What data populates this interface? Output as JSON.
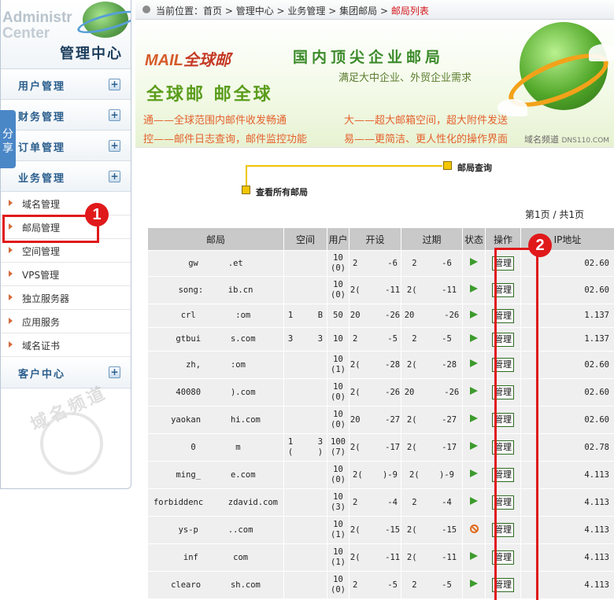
{
  "sidebar": {
    "logo_en_line1": "Administr",
    "logo_en_line2": "Center",
    "logo_cn": "管理中心",
    "sections": [
      {
        "label": "用户管理"
      },
      {
        "label": "财务管理"
      },
      {
        "label": "订单管理"
      },
      {
        "label": "业务管理"
      }
    ],
    "sub_items": [
      {
        "label": "域名管理"
      },
      {
        "label": "邮局管理"
      },
      {
        "label": "空间管理"
      },
      {
        "label": "VPS管理"
      },
      {
        "label": "独立服务器"
      },
      {
        "label": "应用服务"
      },
      {
        "label": "域名证书"
      }
    ],
    "customer_center": "客户中心",
    "expand_symbol": "+",
    "watermark_text": "域名频道"
  },
  "share_tab": "分享",
  "annotations": {
    "one": "1",
    "two": "2"
  },
  "breadcrumb": {
    "prefix": "当前位置：",
    "items": [
      "首页",
      "管理中心",
      "业务管理",
      "集团邮局"
    ],
    "current": "邮局列表",
    "separator": " > "
  },
  "banner": {
    "mail_logo_en": "MAIL",
    "mail_logo_cn": "全球邮",
    "slogan": "全球邮 邮全球",
    "headline": "国内顶尖企业邮局",
    "subheadline": "满足大中企业、外贸企业需求",
    "features": [
      "通——全球范围内邮件收发畅通",
      "大——超大邮箱空间，超大附件发送",
      "控——邮件日志查询，邮件监控功能",
      "易——更简洁、更人性化的操作界面"
    ],
    "brand_cn": "域名频道",
    "brand_en": "DNS110.COM"
  },
  "query": {
    "title": "邮局查询",
    "view_all": "查看所有邮局"
  },
  "pagination": "第1页 / 共1页",
  "table": {
    "headers": [
      "邮局",
      "空间",
      "用户",
      "开设",
      "过期",
      "状态",
      "操作",
      "IP地址"
    ],
    "action_label": "管理",
    "rows": [
      {
        "domain": "gw      .et",
        "space": "",
        "users": "10\n(0)",
        "opened": "2      -6",
        "expires": "2     -6",
        "status": "active",
        "ip": "02.60"
      },
      {
        "domain": "song:     ib.cn",
        "space": "",
        "users": "10\n(0)",
        "opened": "2(     -11",
        "expires": "2(     -11",
        "status": "active",
        "ip": "02.60"
      },
      {
        "domain": "crl        :om",
        "space": "1     B",
        "users": "50",
        "opened": "20     -26",
        "expires": "20      -26",
        "status": "active",
        "ip": "1.137"
      },
      {
        "domain": "gtbui      s.com",
        "space": "3     3",
        "users": "10",
        "opened": "2      -5",
        "expires": "2     -5",
        "status": "active",
        "ip": "1.137"
      },
      {
        "domain": "zh,      :om",
        "space": "",
        "users": "10\n(1)",
        "opened": "2(     -28",
        "expires": "2(     -28",
        "status": "active",
        "ip": "02.60"
      },
      {
        "domain": "40080      ).com",
        "space": "",
        "users": "10\n(0)",
        "opened": "2(     -26",
        "expires": "20      -26",
        "status": "active",
        "ip": "02.60"
      },
      {
        "domain": "yaokan      hi.com",
        "space": "",
        "users": "10\n(0)",
        "opened": "20     -27",
        "expires": "2(     -27",
        "status": "active",
        "ip": "02.60"
      },
      {
        "domain": "0        m",
        "space": "1     3\n(     )",
        "users": "100\n(7)",
        "opened": "2(     -17",
        "expires": "2(     -17",
        "status": "active",
        "ip": "02.78"
      },
      {
        "domain": "ming_      e.com",
        "space": "",
        "users": "10\n(0)",
        "opened": "2(    )-9",
        "expires": "2(    )-9",
        "status": "active",
        "ip": "4.113"
      },
      {
        "domain": "forbiddenc     zdavid.com",
        "space": "",
        "users": "10\n(3)",
        "opened": "2      -4",
        "expires": "2     -4",
        "status": "active",
        "ip": "4.113"
      },
      {
        "domain": "ys-p      ..com",
        "space": "",
        "users": "10\n(1)",
        "opened": "2(     -15",
        "expires": "2(     -15",
        "status": "disabled",
        "ip": "4.113"
      },
      {
        "domain": "inf       com",
        "space": "",
        "users": "10\n(1)",
        "opened": "2(     -11",
        "expires": "2(     -11",
        "status": "active",
        "ip": "4.113"
      },
      {
        "domain": "clearo      sh.com",
        "space": "",
        "users": "10\n(0)",
        "opened": "2      -5",
        "expires": "2     -5",
        "status": "active",
        "ip": "4.113"
      }
    ]
  },
  "colors": {
    "accent_blue": "#2a5d8c",
    "annotation_red": "#e0191b",
    "breadcrumb_current": "#d4161b",
    "status_active": "#3d9b2d",
    "status_disabled": "#e06a1c"
  },
  "icons": {
    "status_active": "play-triangle-icon",
    "status_disabled": "prohibited-icon",
    "section_toggle": "plus-box-icon",
    "sub_item_marker": "triangle-right-icon"
  }
}
